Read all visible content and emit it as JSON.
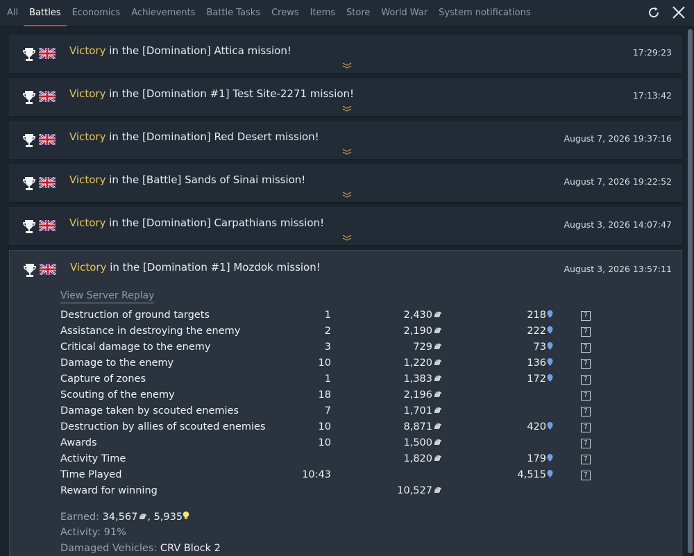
{
  "tabs": [
    {
      "label": "All",
      "active": false
    },
    {
      "label": "Battles",
      "active": true
    },
    {
      "label": "Economics",
      "active": false
    },
    {
      "label": "Achievements",
      "active": false
    },
    {
      "label": "Battle Tasks",
      "active": false
    },
    {
      "label": "Crews",
      "active": false
    },
    {
      "label": "Items",
      "active": false
    },
    {
      "label": "Store",
      "active": false
    },
    {
      "label": "World War",
      "active": false
    },
    {
      "label": "System notifications",
      "active": false
    }
  ],
  "icons": {
    "refresh": "refresh-icon",
    "close": "close-icon",
    "trophy": "trophy-icon",
    "flag": "uk-flag-icon",
    "silver_lions": "silver-lion-icon",
    "research_points": "research-point-icon",
    "gold_bulb": "bulb-icon"
  },
  "colors": {
    "victory": "#e8c45a",
    "accent_tab": "#d0452a",
    "rp": "#6fa0e0"
  },
  "battles": [
    {
      "victory": "Victory",
      "rest": " in the [Domination] Attica mission!",
      "time": "17:29:23"
    },
    {
      "victory": "Victory",
      "rest": " in the [Domination #1] Test Site-2271 mission!",
      "time": "17:13:42"
    },
    {
      "victory": "Victory",
      "rest": " in the [Domination] Red Desert mission!",
      "time": "August 7, 2026 19:37:16"
    },
    {
      "victory": "Victory",
      "rest": " in the [Battle] Sands of Sinai mission!",
      "time": "August 7, 2026 19:22:52"
    },
    {
      "victory": "Victory",
      "rest": " in the [Domination] Carpathians mission!",
      "time": "August 3, 2026 14:07:47"
    }
  ],
  "expanded": {
    "victory": "Victory",
    "rest": " in the [Domination #1] Mozdok mission!",
    "time": "August 3, 2026 13:57:11",
    "replay_label": "View Server Replay",
    "stats": [
      {
        "label": "Destruction of ground targets",
        "count": "1",
        "sl": "2,430",
        "rp": "218",
        "help": "?"
      },
      {
        "label": "Assistance in destroying the enemy",
        "count": "2",
        "sl": "2,190",
        "rp": "222",
        "help": "?"
      },
      {
        "label": "Critical damage to the enemy",
        "count": "3",
        "sl": "729",
        "rp": "73",
        "help": "?"
      },
      {
        "label": "Damage to the enemy",
        "count": "10",
        "sl": "1,220",
        "rp": "136",
        "help": "?"
      },
      {
        "label": "Capture of zones",
        "count": "1",
        "sl": "1,383",
        "rp": "172",
        "help": "?"
      },
      {
        "label": "Scouting of the enemy",
        "count": "18",
        "sl": "2,196",
        "rp": "",
        "help": "?"
      },
      {
        "label": "Damage taken by scouted enemies",
        "count": "7",
        "sl": "1,701",
        "rp": "",
        "help": "?"
      },
      {
        "label": "Destruction by allies of scouted enemies",
        "count": "10",
        "sl": "8,871",
        "rp": "420",
        "help": "?"
      },
      {
        "label": "Awards",
        "count": "10",
        "sl": "1,500",
        "rp": "",
        "help": "?"
      },
      {
        "label": "Activity Time",
        "count": "",
        "sl": "1,820",
        "rp": "179",
        "help": "?"
      },
      {
        "label": "Time Played",
        "count": "10:43",
        "sl": "",
        "rp": "4,515",
        "help": "?"
      },
      {
        "label": "Reward for winning",
        "count": "",
        "sl": "10,527",
        "rp": "",
        "help": ""
      }
    ],
    "earned_label": "Earned:",
    "earned_sl": "34,567",
    "earned_sep": ", ",
    "earned_rp": "5,935",
    "activity_label": "Activity:",
    "activity_value": "91%",
    "damaged_label": "Damaged Vehicles:",
    "damaged_value": "CRV Block 2"
  }
}
